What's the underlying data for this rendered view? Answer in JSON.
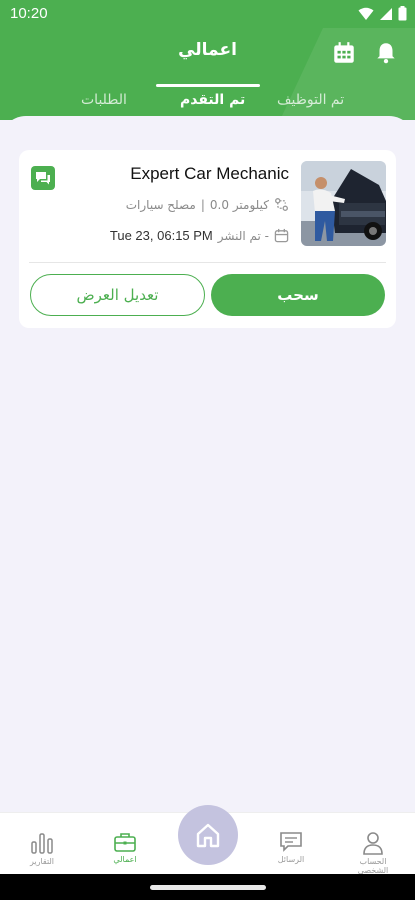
{
  "status": {
    "time": "10:20"
  },
  "header": {
    "title": "اعمالي",
    "tabs": [
      {
        "label": "تم التوظيف"
      },
      {
        "label": "تم التقدم"
      },
      {
        "label": "الطلبات"
      }
    ]
  },
  "card": {
    "title": "Expert Car Mechanic",
    "distance": "كيلومتر 0.0",
    "separator": "|",
    "category": "مصلح سيارات",
    "posted_label": "تم النشر -",
    "posted_date": "Tue 23, 06:15 PM",
    "withdraw_label": "سحب",
    "edit_label": "تعديل العرض"
  },
  "nav": {
    "items": [
      {
        "label": "الحساب الشخصي",
        "icon": "profile-icon"
      },
      {
        "label": "الرسائل",
        "icon": "messages-icon"
      },
      {
        "label": "اعمالي",
        "icon": "briefcase-icon"
      },
      {
        "label": "التقارير",
        "icon": "reports-icon"
      }
    ],
    "home_icon": "home-icon"
  },
  "colors": {
    "accent": "#4caf50",
    "fab": "#c4c3df",
    "background": "#f3f2fa"
  }
}
